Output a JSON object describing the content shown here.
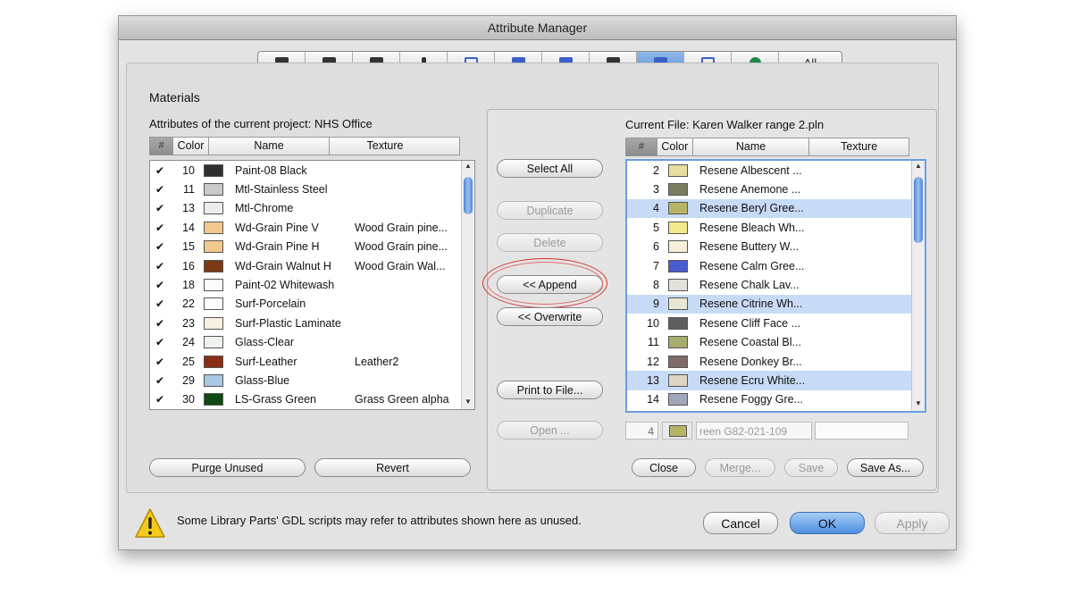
{
  "window": {
    "title": "Attribute Manager"
  },
  "tabs": [
    {
      "name": "layers-tab-icon",
      "glyph": "dark"
    },
    {
      "name": "pens-tab-icon",
      "glyph": "dark"
    },
    {
      "name": "line-types-tab-icon",
      "glyph": "dark"
    },
    {
      "name": "fill-types-tab-icon",
      "glyph": "thin"
    },
    {
      "name": "composites-tab-icon",
      "glyph": "outline"
    },
    {
      "name": "profiles-tab-icon",
      "glyph": "blue"
    },
    {
      "name": "zones-tab-icon",
      "glyph": "blue"
    },
    {
      "name": "markup-tab-icon",
      "glyph": "dark"
    },
    {
      "name": "materials-tab-icon",
      "glyph": "blue",
      "active": true
    },
    {
      "name": "cities-tab-icon",
      "glyph": "outline"
    },
    {
      "name": "globe-tab-icon",
      "glyph": "green"
    },
    {
      "name": "all-tab",
      "label": "All"
    }
  ],
  "left": {
    "section_title": "Materials",
    "caption": "Attributes of the current project: NHS Office",
    "headers": {
      "hash": "#",
      "color": "Color",
      "name": "Name",
      "texture": "Texture"
    },
    "rows": [
      {
        "check": "✔",
        "num": "10",
        "color": "#2f2f2f",
        "name": "Paint-08 Black",
        "texture": ""
      },
      {
        "check": "✔",
        "num": "11",
        "color": "#c9c9c9",
        "name": "Mtl-Stainless Steel",
        "texture": ""
      },
      {
        "check": "✔",
        "num": "13",
        "color": "#ececec",
        "name": "Mtl-Chrome",
        "texture": ""
      },
      {
        "check": "✔",
        "num": "14",
        "color": "#f2c98c",
        "name": "Wd-Grain Pine V",
        "texture": "Wood Grain pine..."
      },
      {
        "check": "✔",
        "num": "15",
        "color": "#f2c98c",
        "name": "Wd-Grain Pine H",
        "texture": "Wood Grain pine..."
      },
      {
        "check": "✔",
        "num": "16",
        "color": "#7a3a14",
        "name": "Wd-Grain Walnut H",
        "texture": "Wood Grain Wal..."
      },
      {
        "check": "✔",
        "num": "18",
        "color": "#fbfbfb",
        "name": "Paint-02 Whitewash",
        "texture": ""
      },
      {
        "check": "✔",
        "num": "22",
        "color": "#ffffff",
        "name": "Surf-Porcelain",
        "texture": ""
      },
      {
        "check": "✔",
        "num": "23",
        "color": "#f7efdf",
        "name": "Surf-Plastic Laminate",
        "texture": ""
      },
      {
        "check": "✔",
        "num": "24",
        "color": "#eef3ee",
        "name": "Glass-Clear",
        "texture": ""
      },
      {
        "check": "✔",
        "num": "25",
        "color": "#8a2e16",
        "name": "Surf-Leather",
        "texture": "Leather2"
      },
      {
        "check": "✔",
        "num": "29",
        "color": "#a9c6e2",
        "name": "Glass-Blue",
        "texture": ""
      },
      {
        "check": "✔",
        "num": "30",
        "color": "#0e4a12",
        "name": "LS-Grass Green",
        "texture": "Grass Green alpha"
      }
    ],
    "purge_label": "Purge Unused",
    "revert_label": "Revert"
  },
  "middle": {
    "select_all": "Select All",
    "duplicate": "Duplicate",
    "delete": "Delete",
    "append": "<< Append",
    "overwrite": "<< Overwrite",
    "print": "Print to File...",
    "open": "Open ..."
  },
  "right": {
    "caption": "Current File: Karen Walker range 2.pln",
    "headers": {
      "hash": "#",
      "color": "Color",
      "name": "Name",
      "texture": "Texture"
    },
    "rows": [
      {
        "num": "2",
        "color": "#e8dca0",
        "name": "Resene Albescent ...",
        "sel": false
      },
      {
        "num": "3",
        "color": "#7a7d60",
        "name": "Resene Anemone ...",
        "sel": false
      },
      {
        "num": "4",
        "color": "#b8b466",
        "name": "Resene Beryl Gree...",
        "sel": true
      },
      {
        "num": "5",
        "color": "#f3e88a",
        "name": "Resene Bleach Wh...",
        "sel": false
      },
      {
        "num": "6",
        "color": "#f7f0d8",
        "name": "Resene Buttery W...",
        "sel": false
      },
      {
        "num": "7",
        "color": "#4a5ad0",
        "name": "Resene Calm Gree...",
        "sel": false
      },
      {
        "num": "8",
        "color": "#e4e0dc",
        "name": "Resene Chalk Lav...",
        "sel": false
      },
      {
        "num": "9",
        "color": "#e9e6d6",
        "name": "Resene Citrine Wh...",
        "sel": true
      },
      {
        "num": "10",
        "color": "#5f5f5f",
        "name": "Resene Cliff Face ...",
        "sel": false
      },
      {
        "num": "11",
        "color": "#a8ac6c",
        "name": "Resene Coastal Bl...",
        "sel": false
      },
      {
        "num": "12",
        "color": "#7e6a66",
        "name": "Resene Donkey Br...",
        "sel": false
      },
      {
        "num": "13",
        "color": "#ddd6c4",
        "name": "Resene Ecru White...",
        "sel": true
      },
      {
        "num": "14",
        "color": "#a2a6bc",
        "name": "Resene Foggy Gre...",
        "sel": false
      }
    ],
    "edit_num": "4",
    "edit_color": "#b8b466",
    "edit_name": "reen G82-021-109",
    "edit_texture": "",
    "close": "Close",
    "merge": "Merge...",
    "save": "Save",
    "save_as": "Save As..."
  },
  "footer": {
    "warning_text": "Some Library Parts' GDL scripts may refer to attributes shown here as unused.",
    "cancel": "Cancel",
    "ok": "OK",
    "apply": "Apply"
  }
}
